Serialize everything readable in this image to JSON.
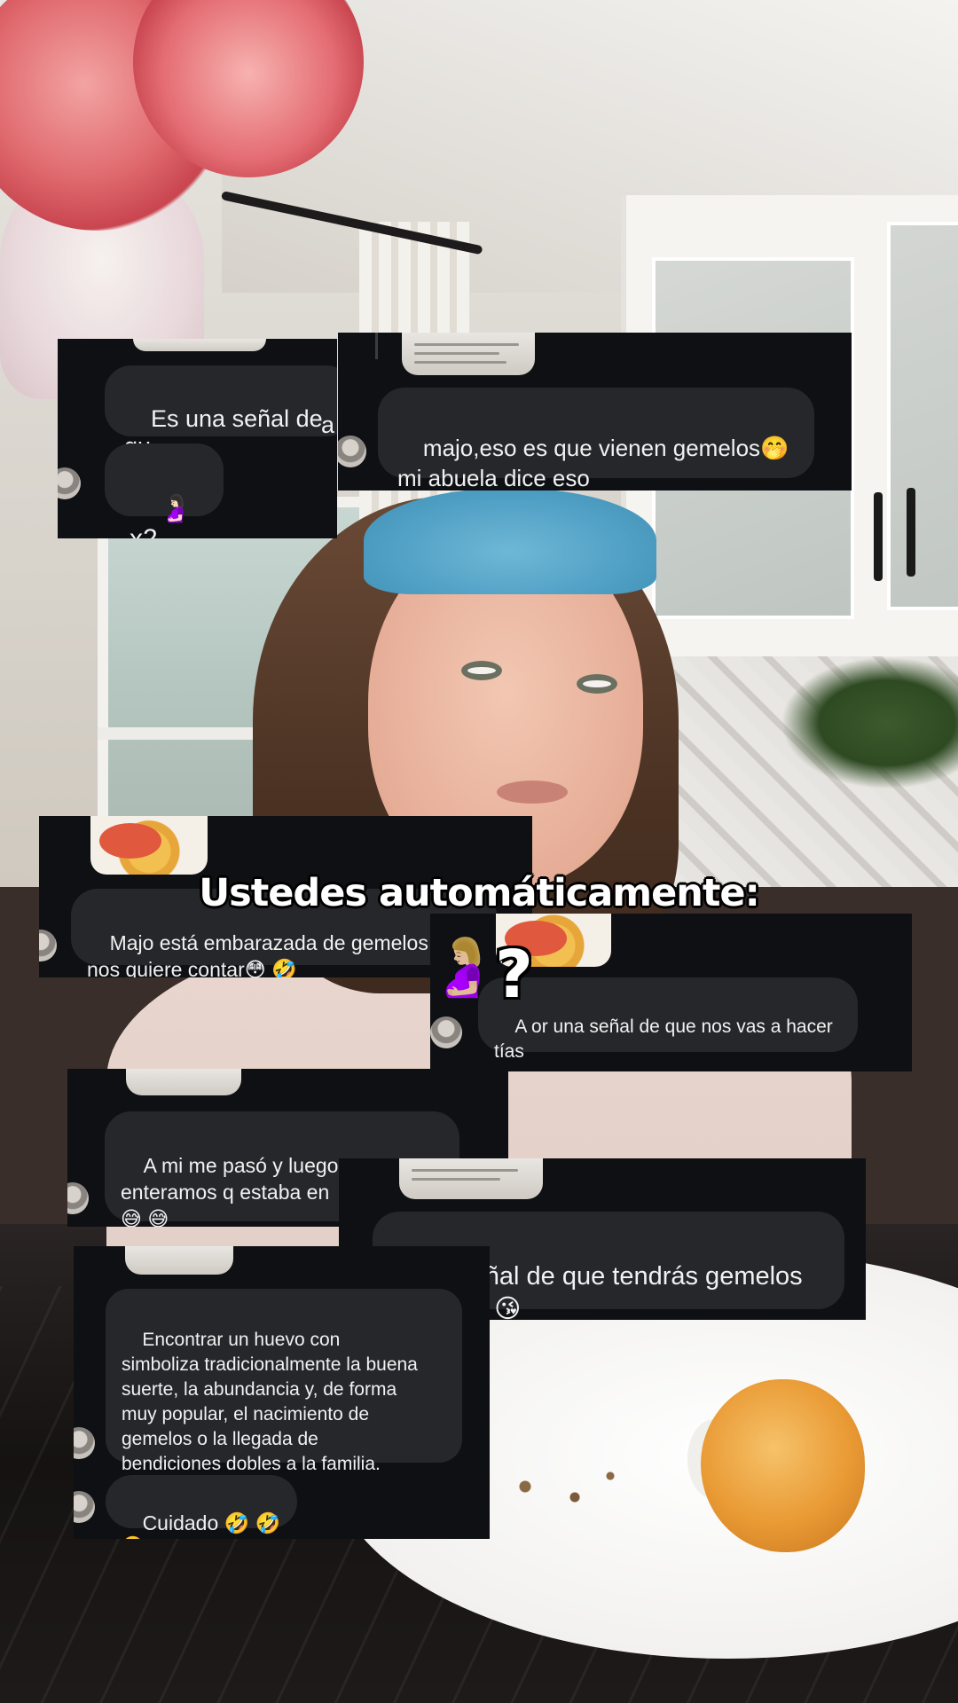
{
  "overlay": {
    "title": "Ustedes automáticamente:",
    "question_mark": "?",
    "emoji": "🤰🏼"
  },
  "comments": {
    "c1": {
      "partial": "Es una señal de qu",
      "partial2": "a",
      "reply": "🤰🏻 x2"
    },
    "c2": {
      "text": "majo,eso es que vienen gemelos🤭\nmi abuela dice eso"
    },
    "c3": {
      "text": "Majo está embarazada de gemelos y no\nnos quiere contar😳 🤣"
    },
    "c4": {
      "text": "A or una señal de que nos vas a hacer\ntías"
    },
    "c5": {
      "text": "A mi me pasó y luego nos\nenteramos q estaba en\n😅 😅"
    },
    "c6": {
      "text": "Es señal de que tendrás gemelos\nmajo ❤️ 😘"
    },
    "c7": {
      "text": "Encontrar un huevo con\nsimboliza tradicionalmente la buena\nsuerte, la abundancia y, de forma\nmuy popular, el nacimiento de\ngemelos o la llegada de\nbendiciones dobles a la familia.",
      "reply": "Cuidado 🤣 🤣 🤣"
    }
  },
  "colors": {
    "card_bg": "#0e1013",
    "bubble_bg": "#25272b",
    "bubble_text": "#f1f1f1",
    "title_text": "#ffffff"
  }
}
